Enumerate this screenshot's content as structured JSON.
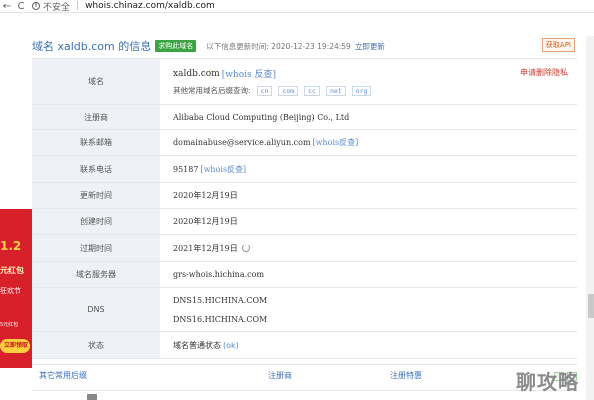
{
  "browser": {
    "back": "←",
    "reload": "C",
    "security": "不安全",
    "url": "whois.chinaz.com/xaldb.com"
  },
  "header": {
    "title": "域名 xaldb.com 的信息",
    "buy_button": "求购此域名",
    "update_info": "以下信息更新时间: 2020-12-23 19:24:59",
    "update_now": "立即更新",
    "favorite": "获取API"
  },
  "table": {
    "domain": {
      "label": "域名",
      "value": "xaldb.com",
      "whois_link": "[whois 反查]",
      "suffix_label": "其他常用域名后缀查询:",
      "suffixes": [
        "cn",
        "com",
        "cc",
        "net",
        "org"
      ],
      "report": "申请删除隐私"
    },
    "registrar": {
      "label": "注册商",
      "value": "Alibaba Cloud Computing (Beijing) Co., Ltd"
    },
    "email": {
      "label": "联系邮箱",
      "value": "domainabuse@service.aliyun.com",
      "link": "[whois反查]"
    },
    "phone": {
      "label": "联系电话",
      "value": "95187",
      "link": "[whois反查]"
    },
    "updated": {
      "label": "更新时间",
      "value": "2020年12月19日"
    },
    "created": {
      "label": "创建时间",
      "value": "2020年12月19日"
    },
    "expires": {
      "label": "过期时间",
      "value": "2021年12月19日"
    },
    "server": {
      "label": "域名服务器",
      "value": "grs-whois.hichina.com"
    },
    "dns": {
      "label": "DNS",
      "values": [
        "DNS15.HICHINA.COM",
        "DNS16.HICHINA.COM"
      ]
    },
    "status": {
      "label": "状态",
      "value": "域名普通状态",
      "ok": "(ok)"
    }
  },
  "footer": {
    "link1": "其它常用后缀",
    "link2": "注册商",
    "link3": "注册特惠"
  },
  "left_ad": {
    "line1": "1.2",
    "line2": "元红包",
    "line3": "狂欢节",
    "line4": "5元红包",
    "button": "立即领取"
  },
  "watermark": "聊攻略"
}
